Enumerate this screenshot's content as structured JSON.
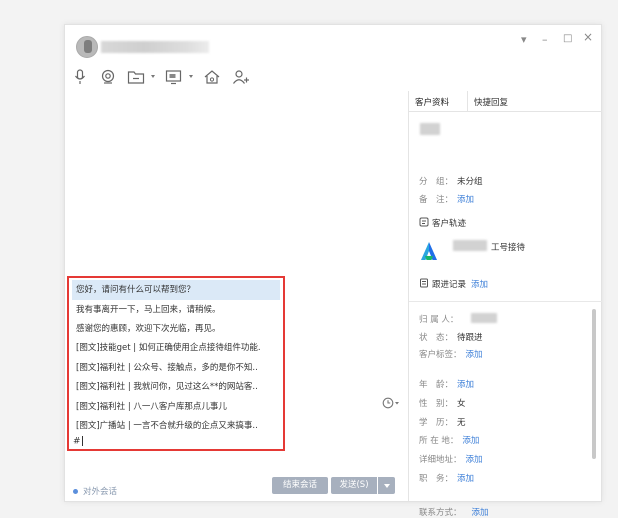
{
  "window": {
    "controls": {
      "pin": "▾",
      "minimize": "–",
      "maximize": "□",
      "close": "×"
    }
  },
  "toolbar": {
    "icons": [
      "microphone-icon",
      "video-icon",
      "folder-icon",
      "screen-share-icon",
      "home-icon",
      "add-user-icon"
    ]
  },
  "quick_replies": [
    "您好，请问有什么可以帮到您？",
    "我有事离开一下，马上回来，请稍候。",
    "感谢您的惠顾，欢迎下次光临，再见。",
    "[图文]技能get | 如何正确使用企点接待组件功能.",
    "[图文]福利社 | 公众号、接触点，多的是你不知..",
    "[图文]福利社 | 我就问你，见过这么**的网站客..",
    "[图文]福利社 | 八一八客户库那点儿事儿",
    "[图文]广播站 | 一言不合就升级的企点又来搞事.."
  ],
  "input": {
    "value": "#"
  },
  "bottom": {
    "external_session": "对外会话",
    "end_session": "结束会话",
    "send": "发送(S)"
  },
  "right_panel": {
    "tabs": [
      "客户资料",
      "快捷回复"
    ],
    "group_label": "分　组：",
    "group_value": "未分组",
    "note_label": "备　注：",
    "note_action": "添加",
    "track_title": "客户轨迹",
    "agent_suffix": "工号接待",
    "followup_title": "跟进记录",
    "followup_action": "添加",
    "owner_label": "归 属 人：",
    "status_label": "状　态：",
    "status_value": "待跟进",
    "tags_label": "客户标签：",
    "tags_action": "添加",
    "age_label": "年　龄：",
    "age_action": "添加",
    "gender_label": "性　别：",
    "gender_value": "女",
    "edu_label": "学　历：",
    "edu_value": "无",
    "location_label": "所 在 地：",
    "location_action": "添加",
    "address_label": "详细地址：",
    "address_action": "添加",
    "job_label": "职　务：",
    "job_action": "添加",
    "contact_label": "联系方式：",
    "contact_action": "添加"
  },
  "colors": {
    "highlight_border": "#e53935",
    "link": "#3d7fd8",
    "button": "#a7b0be",
    "selected_row": "#dbe9f7"
  }
}
